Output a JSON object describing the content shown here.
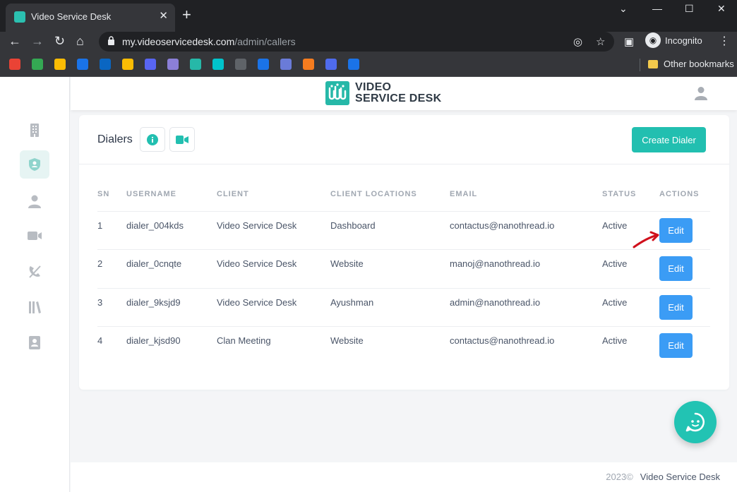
{
  "browser": {
    "tab_title": "Video Service Desk",
    "tab_close": "✕",
    "new_tab": "+",
    "url_host": "my.videoservicedesk.com",
    "url_path": "/admin/callers",
    "incognito_label": "Incognito",
    "other_bookmarks": "Other bookmarks",
    "window_controls": [
      "⌄",
      "—",
      "☐",
      "✕"
    ]
  },
  "bookmarks": [
    {
      "icon": "gmail-icon",
      "color": "#ea4335"
    },
    {
      "icon": "chat-icon",
      "color": "#34a853"
    },
    {
      "icon": "drive-icon",
      "color": "#fbbc04"
    },
    {
      "icon": "check-icon",
      "color": "#1a73e8"
    },
    {
      "icon": "linkedin-icon",
      "color": "#0a66c2"
    },
    {
      "icon": "keep-icon",
      "color": "#fbbc04"
    },
    {
      "icon": "discord-icon",
      "color": "#5865f2"
    },
    {
      "icon": "vsd-icon",
      "color": "#8b7fd8"
    },
    {
      "icon": "vsd-teal-icon",
      "color": "#26b8a8"
    },
    {
      "icon": "canva-icon",
      "color": "#00c4cc"
    },
    {
      "icon": "circle-icon",
      "color": "#5f6368"
    },
    {
      "icon": "refresh-icon",
      "color": "#1a73e8"
    },
    {
      "icon": "compass-icon",
      "color": "#6a7bd8"
    },
    {
      "icon": "box-icon",
      "color": "#f57c1f"
    },
    {
      "icon": "m-icon",
      "color": "#4f6bed"
    },
    {
      "icon": "target-icon",
      "color": "#1a73e8"
    }
  ],
  "header": {
    "logo_line1": "VIDEO",
    "logo_line2": "SERVICE DESK"
  },
  "sidebar": {
    "items": [
      {
        "icon": "building-icon",
        "active": false
      },
      {
        "icon": "shield-user-icon",
        "active": true
      },
      {
        "icon": "person-icon",
        "active": false
      },
      {
        "icon": "video-camera-icon",
        "active": false
      },
      {
        "icon": "phone-off-icon",
        "active": false
      },
      {
        "icon": "library-icon",
        "active": false
      },
      {
        "icon": "contact-icon",
        "active": false
      }
    ]
  },
  "card": {
    "title": "Dialers",
    "create_label": "Create Dialer"
  },
  "table": {
    "headers": [
      "SN",
      "USERNAME",
      "CLIENT",
      "CLIENT LOCATIONS",
      "EMAIL",
      "STATUS",
      "ACTIONS"
    ],
    "rows": [
      {
        "sn": "1",
        "username": "dialer_004kds",
        "client": "Video Service Desk",
        "location": "Dashboard",
        "email": "contactus@nanothread.io",
        "status": "Active",
        "action": "Edit"
      },
      {
        "sn": "2",
        "username": "dialer_0cnqte",
        "client": "Video Service Desk",
        "location": "Website",
        "email": "manoj@nanothread.io",
        "status": "Active",
        "action": "Edit"
      },
      {
        "sn": "3",
        "username": "dialer_9ksjd9",
        "client": "Video Service Desk",
        "location": "Ayushman",
        "email": "admin@nanothread.io",
        "status": "Active",
        "action": "Edit"
      },
      {
        "sn": "4",
        "username": "dialer_kjsd90",
        "client": "Clan Meeting",
        "location": "Website",
        "email": "contactus@nanothread.io",
        "status": "Active",
        "action": "Edit"
      }
    ]
  },
  "footer": {
    "year": "2023©",
    "brand": "Video Service Desk"
  },
  "colors": {
    "accent": "#22bfb0",
    "edit_button": "#3b9cf5",
    "annotation_arrow": "#d0101c"
  }
}
